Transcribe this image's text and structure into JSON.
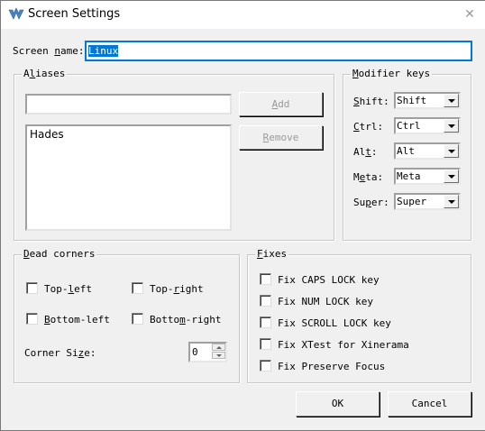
{
  "window": {
    "title": "Screen Settings",
    "close_glyph": "✕"
  },
  "screen_name": {
    "label_pre": "Screen ",
    "label_ul": "n",
    "label_post": "ame:",
    "value": "Linux"
  },
  "aliases": {
    "group_pre": "A",
    "group_ul": "l",
    "group_post": "iases",
    "input_value": "",
    "add_pre": "",
    "add_ul": "A",
    "add_post": "dd",
    "remove_pre": "",
    "remove_ul": "R",
    "remove_post": "emove",
    "items": [
      "Hades"
    ]
  },
  "modifier_keys": {
    "group_pre": "",
    "group_ul": "M",
    "group_post": "odifier keys",
    "rows": [
      {
        "pre": "",
        "ul": "S",
        "post": "hift:",
        "value": "Shift"
      },
      {
        "pre": "",
        "ul": "C",
        "post": "trl:",
        "value": "Ctrl"
      },
      {
        "pre": "Al",
        "ul": "t",
        "post": ":",
        "value": "Alt"
      },
      {
        "pre": "M",
        "ul": "e",
        "post": "ta:",
        "value": "Meta"
      },
      {
        "pre": "Su",
        "ul": "p",
        "post": "er:",
        "value": "Super"
      }
    ]
  },
  "dead_corners": {
    "group_pre": "",
    "group_ul": "D",
    "group_post": "ead corners",
    "top_left": {
      "pre": "Top-",
      "ul": "l",
      "post": "eft",
      "checked": false
    },
    "top_right": {
      "pre": "Top-",
      "ul": "r",
      "post": "ight",
      "checked": false
    },
    "bottom_left": {
      "pre": "",
      "ul": "B",
      "post": "ottom-left",
      "checked": false
    },
    "bottom_right": {
      "pre": "Botto",
      "ul": "m",
      "post": "-right",
      "checked": false
    },
    "corner_size_pre": "Corner Si",
    "corner_size_ul": "z",
    "corner_size_post": "e:",
    "corner_size_value": "0"
  },
  "fixes": {
    "group_pre": "",
    "group_ul": "F",
    "group_post": "ixes",
    "items": [
      {
        "label": "Fix CAPS LOCK key",
        "checked": false
      },
      {
        "label": "Fix NUM LOCK key",
        "checked": false
      },
      {
        "label": "Fix SCROLL LOCK key",
        "checked": false
      },
      {
        "label": "Fix XTest for Xinerama",
        "checked": false
      },
      {
        "label": "Fix Preserve Focus",
        "checked": false
      }
    ]
  },
  "buttons": {
    "ok": "OK",
    "cancel": "Cancel"
  }
}
